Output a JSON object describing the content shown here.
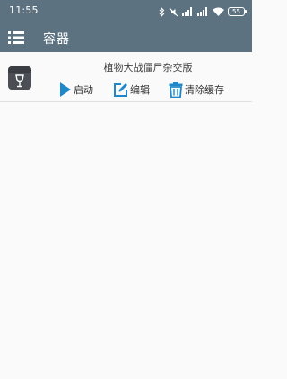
{
  "status_bar": {
    "time": "11:55",
    "battery": "55"
  },
  "app_bar": {
    "title": "容器"
  },
  "container": {
    "name": "植物大战僵尸杂交版",
    "actions": {
      "launch": "启动",
      "edit": "编辑",
      "clear_cache": "清除缓存"
    }
  },
  "colors": {
    "toolbar": "#5c7280",
    "accent": "#1e88c8",
    "background": "#fafafa"
  }
}
